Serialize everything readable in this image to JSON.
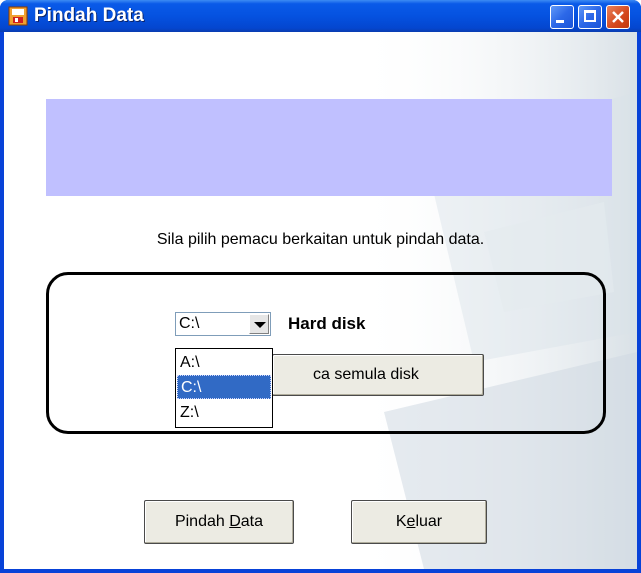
{
  "window": {
    "title": "Pindah Data",
    "accent_color": "#0842d8",
    "close_color": "#d4471c",
    "banner_color": "#c0c0ff"
  },
  "titlebar_buttons": {
    "minimize_icon": "minimize-icon",
    "maximize_icon": "maximize-icon",
    "close_icon": "close-icon",
    "close_glyph": "✕"
  },
  "main": {
    "instruction": "Sila pilih pemacu berkaitan untuk pindah data.",
    "drive_combo_value": "C:\\",
    "drive_label": "Hard disk",
    "refresh_button_label": "ca semula disk",
    "drive_options": [
      "A:\\",
      "C:\\",
      "Z:\\"
    ],
    "selected_option_index": 1
  },
  "buttons": {
    "move_label": "Pindah Data",
    "move_mnemonic": "D",
    "exit_label": "Keluar",
    "exit_mnemonic": "e"
  }
}
